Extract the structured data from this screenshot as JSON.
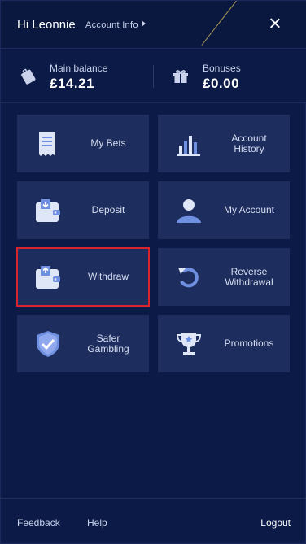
{
  "header": {
    "greeting": "Hi Leonnie",
    "account_info_label": "Account Info"
  },
  "balances": {
    "main": {
      "label": "Main balance",
      "value": "£14.21",
      "icon": "wallet-tag-icon"
    },
    "bonuses": {
      "label": "Bonuses",
      "value": "£0.00",
      "icon": "gift-icon"
    }
  },
  "tiles": [
    {
      "label": "My Bets",
      "icon": "receipt-icon"
    },
    {
      "label": "Account\nHistory",
      "icon": "bar-chart-icon"
    },
    {
      "label": "Deposit",
      "icon": "wallet-in-icon"
    },
    {
      "label": "My Account",
      "icon": "user-icon"
    },
    {
      "label": "Withdraw",
      "icon": "wallet-out-icon",
      "selected": true
    },
    {
      "label": "Reverse\nWithdrawal",
      "icon": "undo-icon"
    },
    {
      "label": "Safer\nGambling",
      "icon": "shield-check-icon"
    },
    {
      "label": "Promotions",
      "icon": "trophy-icon"
    }
  ],
  "footer": {
    "feedback": "Feedback",
    "help": "Help",
    "logout": "Logout"
  },
  "colors": {
    "background": "#0b1a47",
    "tile": "#1d2d5e",
    "icon": "#6f8fe0",
    "selection": "#d9232e",
    "accent_line": "#b8a458"
  }
}
